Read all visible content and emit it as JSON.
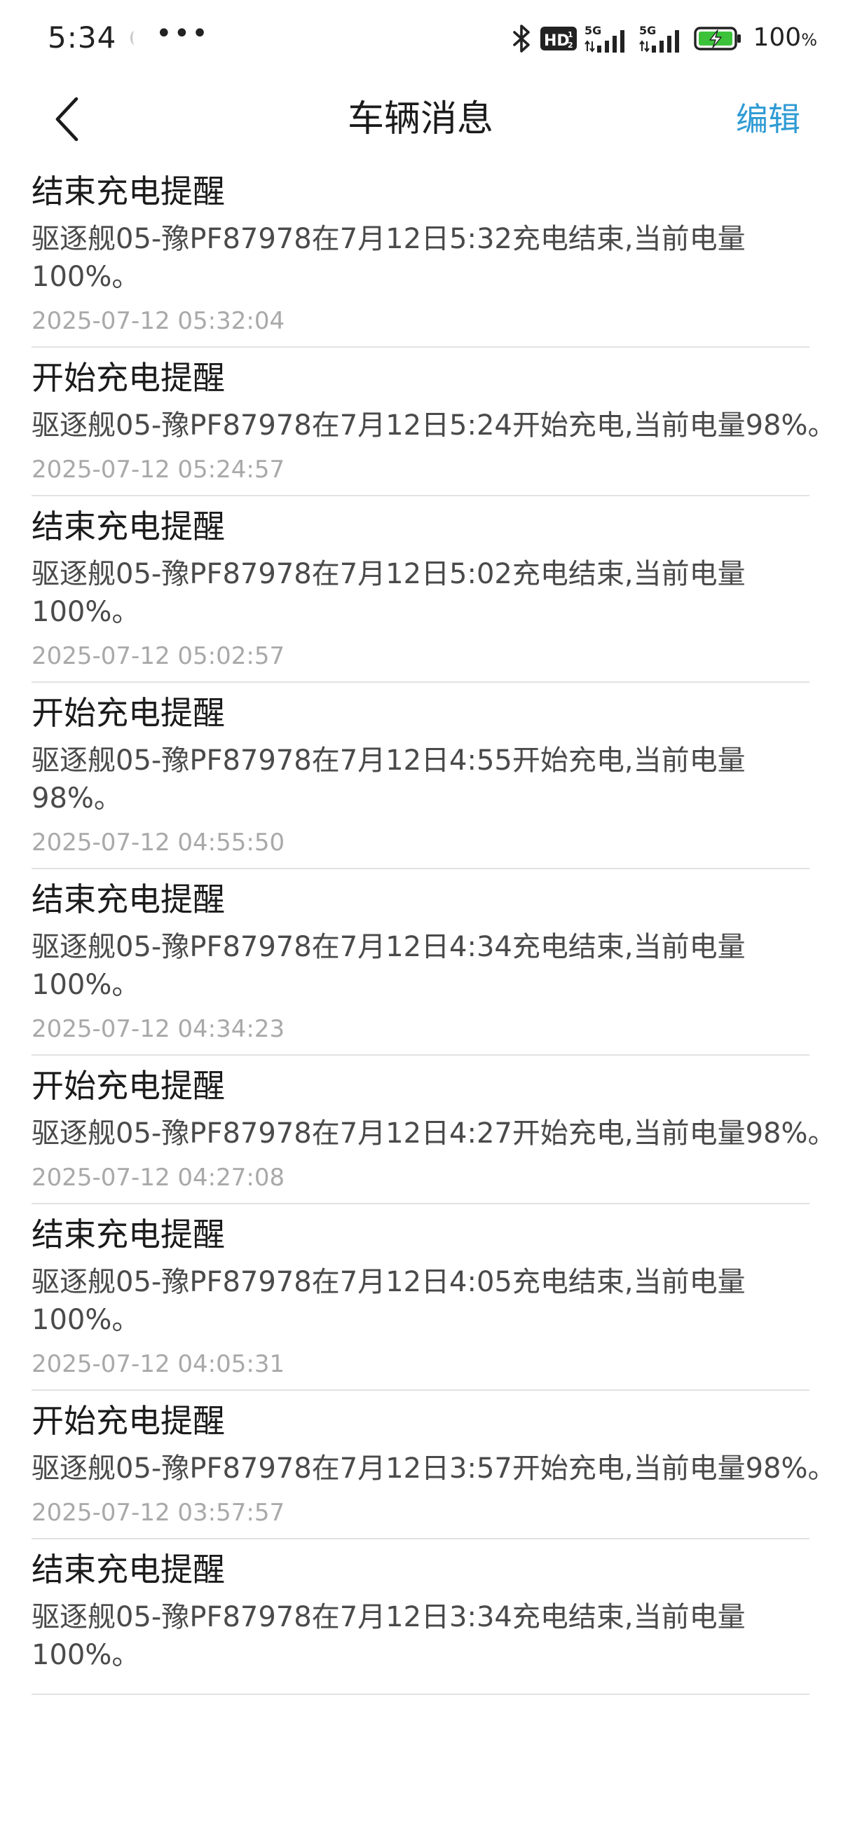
{
  "status_bar": {
    "time": "5:34",
    "more": "•••",
    "battery_level": "100",
    "battery_unit": "%",
    "icons": [
      "bluetooth-icon",
      "hd-voice-icon",
      "5g-signal-icon",
      "5g-signal-icon",
      "battery-charging-icon"
    ]
  },
  "header": {
    "title": "车辆消息",
    "edit_label": "编辑",
    "back_icon": "chevron-left-icon",
    "accent_color": "#2f9bd4"
  },
  "messages": [
    {
      "title": "结束充电提醒",
      "body": "驱逐舰05-豫PF87978在7月12日5:32充电结束,当前电量100%。",
      "time": "2025-07-12 05:32:04"
    },
    {
      "title": "开始充电提醒",
      "body": "驱逐舰05-豫PF87978在7月12日5:24开始充电,当前电量98%。",
      "time": "2025-07-12 05:24:57"
    },
    {
      "title": "结束充电提醒",
      "body": "驱逐舰05-豫PF87978在7月12日5:02充电结束,当前电量100%。",
      "time": "2025-07-12 05:02:57"
    },
    {
      "title": "开始充电提醒",
      "body": "驱逐舰05-豫PF87978在7月12日4:55开始充电,当前电量98%。",
      "time": "2025-07-12 04:55:50"
    },
    {
      "title": "结束充电提醒",
      "body": "驱逐舰05-豫PF87978在7月12日4:34充电结束,当前电量100%。",
      "time": "2025-07-12 04:34:23"
    },
    {
      "title": "开始充电提醒",
      "body": "驱逐舰05-豫PF87978在7月12日4:27开始充电,当前电量98%。",
      "time": "2025-07-12 04:27:08"
    },
    {
      "title": "结束充电提醒",
      "body": "驱逐舰05-豫PF87978在7月12日4:05充电结束,当前电量100%。",
      "time": "2025-07-12 04:05:31"
    },
    {
      "title": "开始充电提醒",
      "body": "驱逐舰05-豫PF87978在7月12日3:57开始充电,当前电量98%。",
      "time": "2025-07-12 03:57:57"
    },
    {
      "title": "结束充电提醒",
      "body": "驱逐舰05-豫PF87978在7月12日3:34充电结束,当前电量100%。",
      "time": ""
    }
  ]
}
